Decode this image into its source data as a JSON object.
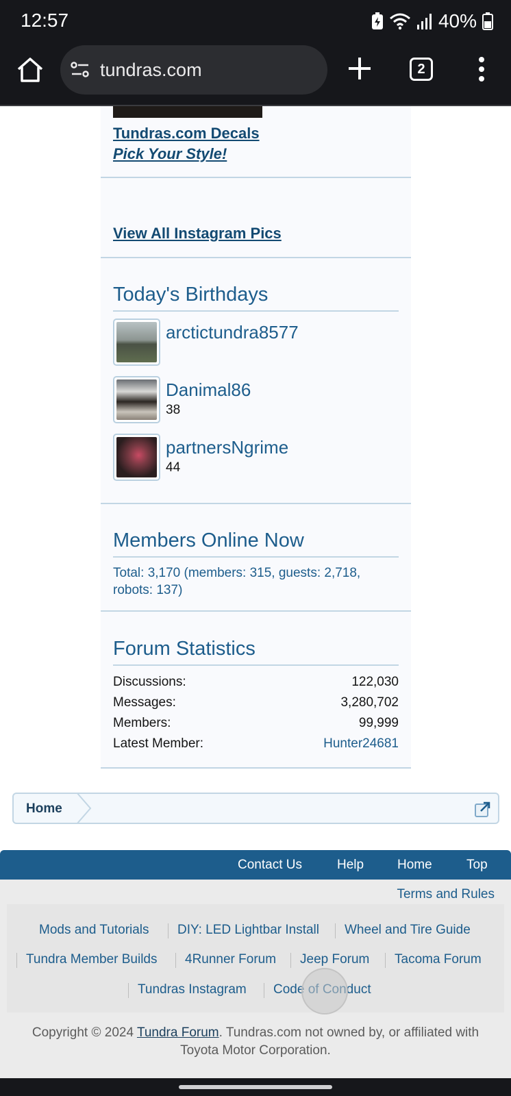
{
  "status_bar": {
    "time": "12:57",
    "battery_percent": "40%"
  },
  "browser": {
    "url": "tundras.com",
    "tab_count": "2"
  },
  "sidebar": {
    "ad": {
      "link_title": "Tundras.com Decals",
      "link_subtitle": "Pick Your Style!"
    },
    "instagram_link": "View All Instagram Pics",
    "birthdays": {
      "title": "Today's Birthdays",
      "members": [
        {
          "name": "arctictundra8577",
          "age": ""
        },
        {
          "name": "Danimal86",
          "age": "38"
        },
        {
          "name": "partnersNgrime",
          "age": "44"
        }
      ]
    },
    "members_online": {
      "title": "Members Online Now",
      "summary": "Total: 3,170 (members: 315, guests: 2,718, robots: 137)"
    },
    "forum_stats": {
      "title": "Forum Statistics",
      "rows": [
        {
          "label": "Discussions:",
          "value": "122,030"
        },
        {
          "label": "Messages:",
          "value": "3,280,702"
        },
        {
          "label": "Members:",
          "value": "99,999"
        },
        {
          "label": "Latest Member:",
          "value": "Hunter24681"
        }
      ]
    }
  },
  "breadcrumb": {
    "home": "Home"
  },
  "footer": {
    "nav": [
      "Contact Us",
      "Help",
      "Home",
      "Top"
    ],
    "terms": "Terms and Rules",
    "links": [
      "Mods and Tutorials",
      "DIY: LED Lightbar Install",
      "Wheel and Tire Guide",
      "Tundra Member Builds",
      "4Runner Forum",
      "Jeep Forum",
      "Tacoma Forum",
      "Tundras Instagram",
      "Code of Conduct"
    ],
    "copyright_prefix": "Copyright © 2024 ",
    "copyright_link": "Tundra Forum",
    "copyright_suffix": ". Tundras.com not owned by, or affiliated with Toyota Motor Corporation."
  },
  "colors": {
    "accent": "#1d5d8c",
    "link_dark": "#134a72",
    "system_bar": "#16171b",
    "footer_bg": "#ebebeb"
  },
  "icons": [
    "home-icon",
    "site-settings-icon",
    "plus-icon",
    "tab-switcher-icon",
    "more-vert-icon",
    "wifi-icon",
    "signal-icon",
    "battery-icon",
    "battery-saver-icon",
    "external-link-icon"
  ]
}
